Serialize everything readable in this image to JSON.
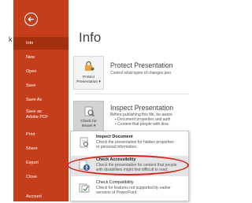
{
  "background_fragment": "k",
  "nav": {
    "items": [
      {
        "label": "Info"
      },
      {
        "label": "New"
      },
      {
        "label": "Open"
      },
      {
        "label": "Save"
      },
      {
        "label": "Save As"
      },
      {
        "label": "Save as Adobe PDF"
      },
      {
        "label": "Print"
      },
      {
        "label": "Share"
      },
      {
        "label": "Export"
      },
      {
        "label": "Close"
      },
      {
        "label": "Account"
      }
    ],
    "selected": "Info",
    "accent": "#c43e1c"
  },
  "main": {
    "title": "Info",
    "protect": {
      "tile_line1": "Protect",
      "tile_line2": "Presentation ▾",
      "title": "Protect Presentation",
      "desc": "Control what types of changes peo"
    },
    "inspect": {
      "tile_line1": "Check for",
      "tile_line2": "Issues ▾",
      "title": "Inspect Presentation",
      "desc": "Before publishing this file, be aware",
      "bullet1": "Document properties and auth",
      "bullet2": "Content that people with disa"
    }
  },
  "menu": {
    "items": [
      {
        "title": "Inspect Document",
        "desc1": "Check the presentation for hidden properties",
        "desc2": "or personal information."
      },
      {
        "title": "Check Accessibility",
        "desc1": "Check the presentation for content that people",
        "desc2": "with disabilities might find difficult to read."
      },
      {
        "title": "Check Compatibility",
        "desc1": "Check for features not supported by earlier",
        "desc2": "versions of PowerPoint."
      }
    ],
    "highlighted": "Check Accessibility",
    "ring_color": "#d62620"
  }
}
